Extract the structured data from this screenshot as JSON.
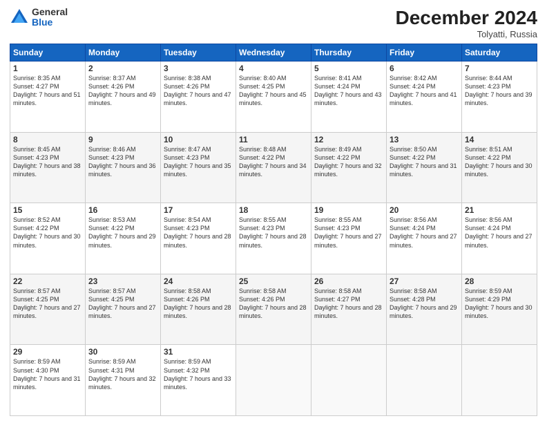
{
  "logo": {
    "general": "General",
    "blue": "Blue"
  },
  "title": "December 2024",
  "location": "Tolyatti, Russia",
  "days_of_week": [
    "Sunday",
    "Monday",
    "Tuesday",
    "Wednesday",
    "Thursday",
    "Friday",
    "Saturday"
  ],
  "weeks": [
    [
      {
        "day": "1",
        "sunrise": "8:35 AM",
        "sunset": "4:27 PM",
        "daylight": "7 hours and 51 minutes."
      },
      {
        "day": "2",
        "sunrise": "8:37 AM",
        "sunset": "4:26 PM",
        "daylight": "7 hours and 49 minutes."
      },
      {
        "day": "3",
        "sunrise": "8:38 AM",
        "sunset": "4:26 PM",
        "daylight": "7 hours and 47 minutes."
      },
      {
        "day": "4",
        "sunrise": "8:40 AM",
        "sunset": "4:25 PM",
        "daylight": "7 hours and 45 minutes."
      },
      {
        "day": "5",
        "sunrise": "8:41 AM",
        "sunset": "4:24 PM",
        "daylight": "7 hours and 43 minutes."
      },
      {
        "day": "6",
        "sunrise": "8:42 AM",
        "sunset": "4:24 PM",
        "daylight": "7 hours and 41 minutes."
      },
      {
        "day": "7",
        "sunrise": "8:44 AM",
        "sunset": "4:23 PM",
        "daylight": "7 hours and 39 minutes."
      }
    ],
    [
      {
        "day": "8",
        "sunrise": "8:45 AM",
        "sunset": "4:23 PM",
        "daylight": "7 hours and 38 minutes."
      },
      {
        "day": "9",
        "sunrise": "8:46 AM",
        "sunset": "4:23 PM",
        "daylight": "7 hours and 36 minutes."
      },
      {
        "day": "10",
        "sunrise": "8:47 AM",
        "sunset": "4:23 PM",
        "daylight": "7 hours and 35 minutes."
      },
      {
        "day": "11",
        "sunrise": "8:48 AM",
        "sunset": "4:22 PM",
        "daylight": "7 hours and 34 minutes."
      },
      {
        "day": "12",
        "sunrise": "8:49 AM",
        "sunset": "4:22 PM",
        "daylight": "7 hours and 32 minutes."
      },
      {
        "day": "13",
        "sunrise": "8:50 AM",
        "sunset": "4:22 PM",
        "daylight": "7 hours and 31 minutes."
      },
      {
        "day": "14",
        "sunrise": "8:51 AM",
        "sunset": "4:22 PM",
        "daylight": "7 hours and 30 minutes."
      }
    ],
    [
      {
        "day": "15",
        "sunrise": "8:52 AM",
        "sunset": "4:22 PM",
        "daylight": "7 hours and 30 minutes."
      },
      {
        "day": "16",
        "sunrise": "8:53 AM",
        "sunset": "4:22 PM",
        "daylight": "7 hours and 29 minutes."
      },
      {
        "day": "17",
        "sunrise": "8:54 AM",
        "sunset": "4:23 PM",
        "daylight": "7 hours and 28 minutes."
      },
      {
        "day": "18",
        "sunrise": "8:55 AM",
        "sunset": "4:23 PM",
        "daylight": "7 hours and 28 minutes."
      },
      {
        "day": "19",
        "sunrise": "8:55 AM",
        "sunset": "4:23 PM",
        "daylight": "7 hours and 27 minutes."
      },
      {
        "day": "20",
        "sunrise": "8:56 AM",
        "sunset": "4:24 PM",
        "daylight": "7 hours and 27 minutes."
      },
      {
        "day": "21",
        "sunrise": "8:56 AM",
        "sunset": "4:24 PM",
        "daylight": "7 hours and 27 minutes."
      }
    ],
    [
      {
        "day": "22",
        "sunrise": "8:57 AM",
        "sunset": "4:25 PM",
        "daylight": "7 hours and 27 minutes."
      },
      {
        "day": "23",
        "sunrise": "8:57 AM",
        "sunset": "4:25 PM",
        "daylight": "7 hours and 27 minutes."
      },
      {
        "day": "24",
        "sunrise": "8:58 AM",
        "sunset": "4:26 PM",
        "daylight": "7 hours and 28 minutes."
      },
      {
        "day": "25",
        "sunrise": "8:58 AM",
        "sunset": "4:26 PM",
        "daylight": "7 hours and 28 minutes."
      },
      {
        "day": "26",
        "sunrise": "8:58 AM",
        "sunset": "4:27 PM",
        "daylight": "7 hours and 28 minutes."
      },
      {
        "day": "27",
        "sunrise": "8:58 AM",
        "sunset": "4:28 PM",
        "daylight": "7 hours and 29 minutes."
      },
      {
        "day": "28",
        "sunrise": "8:59 AM",
        "sunset": "4:29 PM",
        "daylight": "7 hours and 30 minutes."
      }
    ],
    [
      {
        "day": "29",
        "sunrise": "8:59 AM",
        "sunset": "4:30 PM",
        "daylight": "7 hours and 31 minutes."
      },
      {
        "day": "30",
        "sunrise": "8:59 AM",
        "sunset": "4:31 PM",
        "daylight": "7 hours and 32 minutes."
      },
      {
        "day": "31",
        "sunrise": "8:59 AM",
        "sunset": "4:32 PM",
        "daylight": "7 hours and 33 minutes."
      },
      null,
      null,
      null,
      null
    ]
  ]
}
